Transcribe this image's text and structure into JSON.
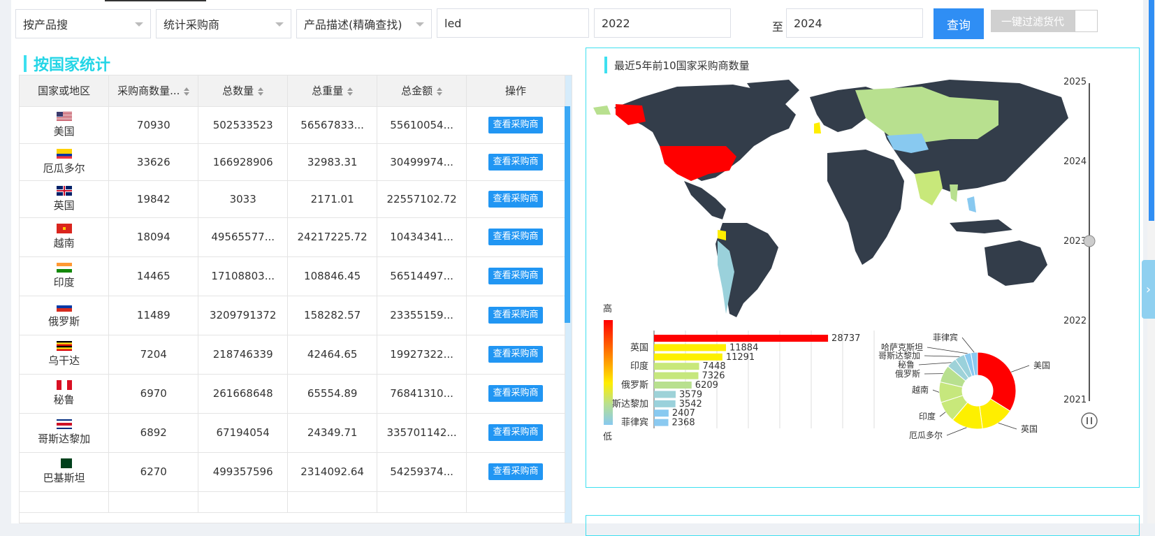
{
  "search": {
    "mode_select": "按产品搜",
    "stat_select": "统计采购商",
    "field_select": "产品描述(精确查找)",
    "keyword": "led",
    "year_from": "2022",
    "year_to": "2024",
    "to_label": "至",
    "query_button": "查询",
    "filter_button": "一键过滤货代"
  },
  "section_title": "按国家统计",
  "table": {
    "columns": [
      "国家或地区",
      "采购商数量...",
      "总数量",
      "总重量",
      "总金额",
      "操作"
    ],
    "action_label": "查看采购商",
    "rows": [
      {
        "country": "美国",
        "buyers": "70930",
        "qty": "502533523",
        "weight": "56567833...",
        "amount": "55610054...",
        "flag": "us"
      },
      {
        "country": "厄瓜多尔",
        "buyers": "33626",
        "qty": "166928906",
        "weight": "32983.31",
        "amount": "30499974...",
        "flag": "ec"
      },
      {
        "country": "英国",
        "buyers": "19842",
        "qty": "3033",
        "weight": "2171.01",
        "amount": "22557102.72",
        "flag": "gb"
      },
      {
        "country": "越南",
        "buyers": "18094",
        "qty": "49565577...",
        "weight": "24217225.72",
        "amount": "10434341...",
        "flag": "vn"
      },
      {
        "country": "印度",
        "buyers": "14465",
        "qty": "17108803...",
        "weight": "108846.45",
        "amount": "56514497...",
        "flag": "in"
      },
      {
        "country": "俄罗斯",
        "buyers": "11489",
        "qty": "3209791372",
        "weight": "158282.57",
        "amount": "23355159...",
        "flag": "ru"
      },
      {
        "country": "乌干达",
        "buyers": "7204",
        "qty": "218746339",
        "weight": "42464.65",
        "amount": "19927322...",
        "flag": "ug"
      },
      {
        "country": "秘鲁",
        "buyers": "6970",
        "qty": "261668648",
        "weight": "65554.89",
        "amount": "76841310...",
        "flag": "pe"
      },
      {
        "country": "哥斯达黎加",
        "buyers": "6892",
        "qty": "67194054",
        "weight": "24349.71",
        "amount": "335701142...",
        "flag": "cr"
      },
      {
        "country": "巴基斯坦",
        "buyers": "6270",
        "qty": "499357596",
        "weight": "2314092.64",
        "amount": "54259374...",
        "flag": "pk"
      }
    ]
  },
  "chart": {
    "title": "最近5年前10国家采购商数量",
    "legend_high": "高",
    "legend_low": "低",
    "timeline_years": [
      "2025",
      "2024",
      "2023",
      "2022",
      "2021"
    ],
    "current_year": "2023"
  },
  "chart_data": {
    "type": "bar",
    "categories": [
      "",
      "英国",
      "",
      "印度",
      "",
      "俄罗斯",
      "",
      "斯达黎加",
      "",
      "菲律宾"
    ],
    "values": [
      28737,
      11884,
      11291,
      7448,
      7326,
      6209,
      3579,
      3542,
      2407,
      2368
    ],
    "value_labels": [
      "28737",
      "11884",
      "11291",
      "7448",
      "7326",
      "6209",
      "3579",
      "3542",
      "2407",
      "2368"
    ],
    "colors": [
      "#ff0000",
      "#ffee00",
      "#fdf000",
      "#c8e87a",
      "#c6e77d",
      "#b8e08f",
      "#9ed2d8",
      "#9ad1db",
      "#88c9f0",
      "#8ac9f0"
    ],
    "pie_labels": [
      "美国",
      "英国",
      "厄瓜多尔",
      "印度",
      "越南",
      "俄罗斯",
      "秘鲁",
      "哥斯达黎加",
      "哈萨克斯坦",
      "菲律宾"
    ]
  }
}
